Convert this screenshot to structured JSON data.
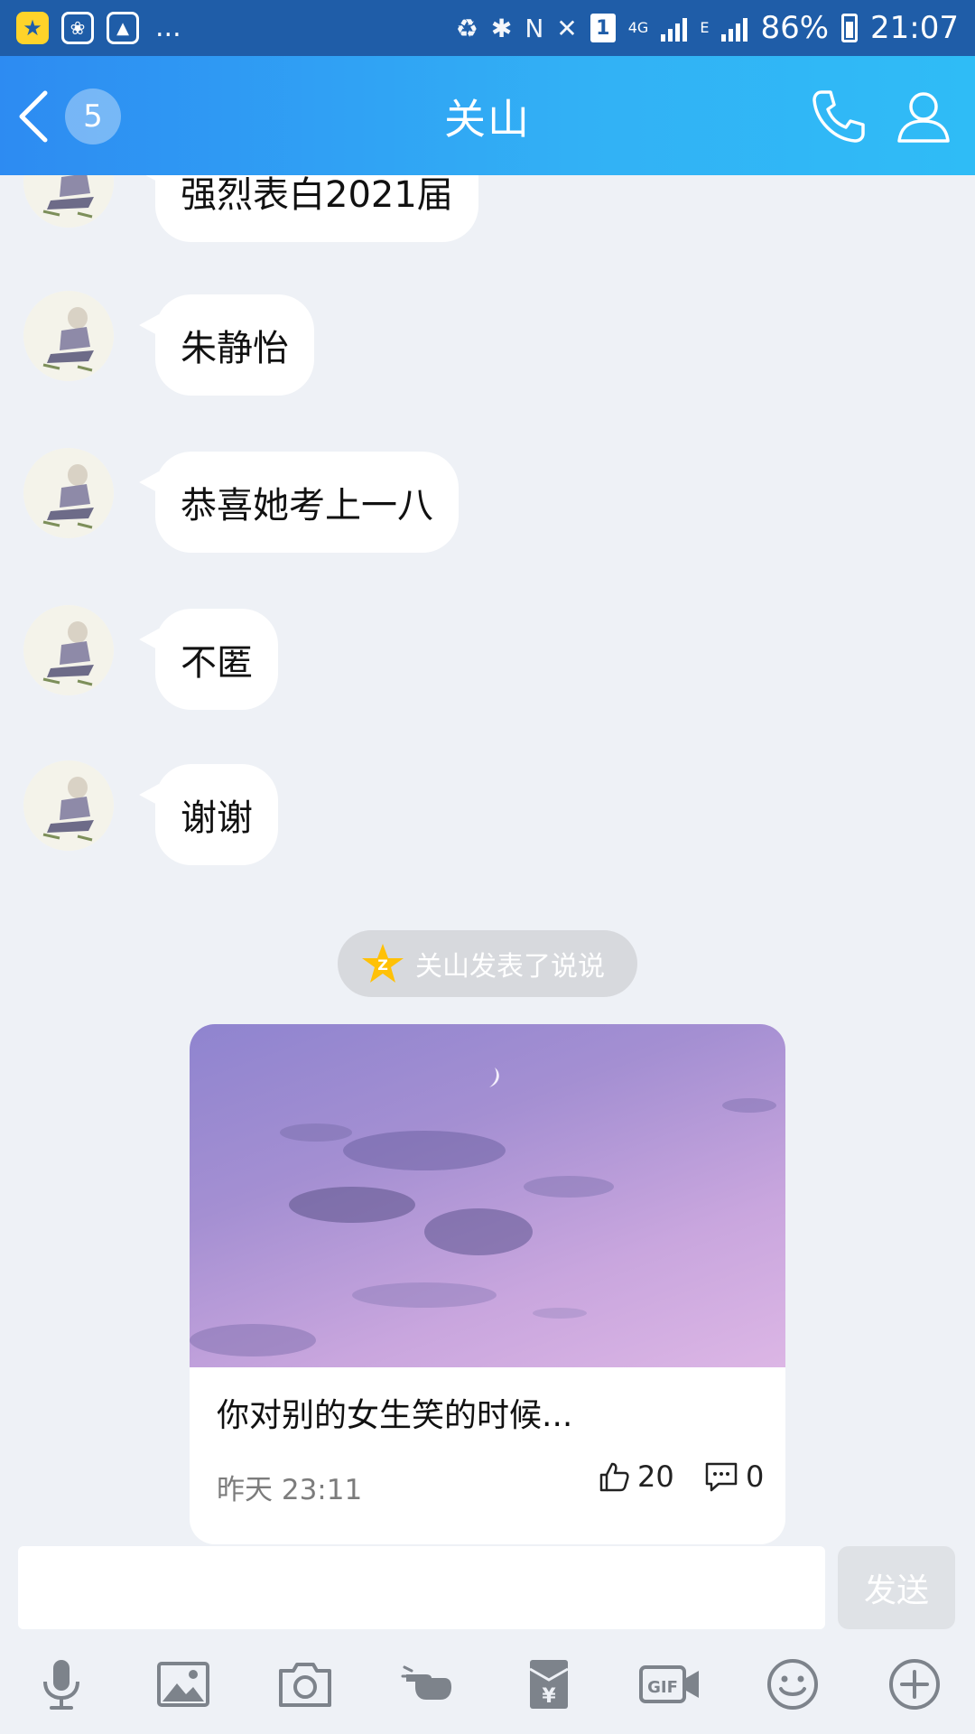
{
  "status_bar": {
    "battery": "86%",
    "time": "21:07",
    "sim": "1",
    "network": "4G",
    "network2": "E",
    "notifications_more": "..."
  },
  "header": {
    "back_badge": "5",
    "title": "关山",
    "icons": [
      "back-chevron-icon",
      "phone-icon",
      "profile-icon"
    ]
  },
  "messages": [
    {
      "text": "强烈表白2021届"
    },
    {
      "text": "朱静怡"
    },
    {
      "text": "恭喜她考上一八"
    },
    {
      "text": "不匿"
    },
    {
      "text": "谢谢"
    }
  ],
  "system_note": {
    "text": "关山发表了说说",
    "icon": "qzone-star-icon"
  },
  "post_card": {
    "text": "你对别的女生笑的时候...",
    "time": "昨天 23:11",
    "likes": "20",
    "comments": "0"
  },
  "input": {
    "value": "",
    "send_label": "发送"
  },
  "toolbar": {
    "icons": [
      "microphone-icon",
      "image-icon",
      "camera-icon",
      "poke-hand-icon",
      "red-packet-icon",
      "gif-icon",
      "emoji-icon",
      "plus-icon"
    ]
  },
  "colors": {
    "header_start": "#2d8bf2",
    "header_end": "#2fbcf6",
    "status_bar": "#1f5da8",
    "chat_bg": "#eef1f6"
  }
}
